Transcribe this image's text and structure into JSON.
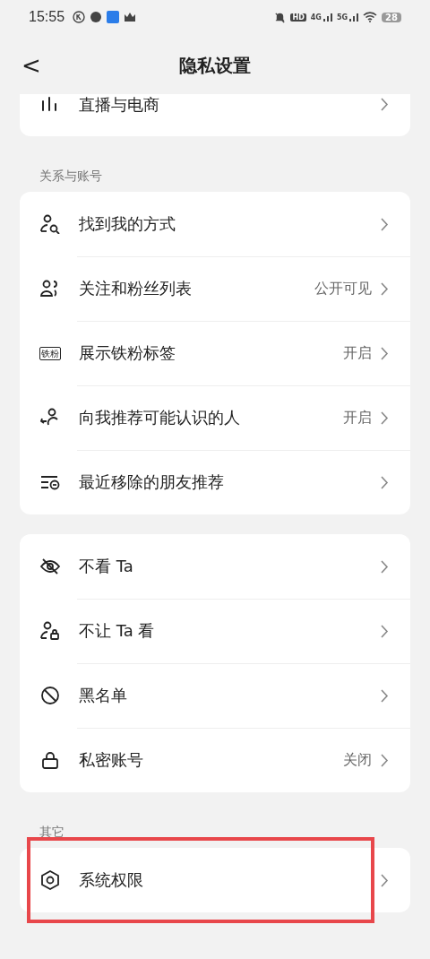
{
  "status_bar": {
    "time": "15:55",
    "hd": "HD",
    "networks": [
      "4G",
      "5G"
    ],
    "battery": "28"
  },
  "header": {
    "back": "<",
    "title": "隐私设置"
  },
  "sections": [
    {
      "rows": [
        {
          "label": "直播与电商",
          "highlighted": false
        }
      ]
    },
    {
      "heading": "关系与账号",
      "rows": [
        {
          "label": "找到我的方式",
          "highlighted": false
        },
        {
          "label": "关注和粉丝列表",
          "value": "公开可见",
          "highlighted": false
        },
        {
          "label": "展示铁粉标签",
          "value": "开启",
          "badge": "铁粉",
          "highlighted": false
        },
        {
          "label": "向我推荐可能认识的人",
          "value": "开启",
          "highlighted": false
        },
        {
          "label": "最近移除的朋友推荐",
          "highlighted": false
        }
      ]
    },
    {
      "rows": [
        {
          "label": "不看 Ta",
          "highlighted": false
        },
        {
          "label": "不让 Ta 看",
          "highlighted": false
        },
        {
          "label": "黑名单",
          "highlighted": false
        },
        {
          "label": "私密账号",
          "value": "关闭",
          "highlighted": false
        }
      ]
    },
    {
      "heading": "其它",
      "rows": [
        {
          "label": "系统权限",
          "highlighted": true
        }
      ]
    }
  ]
}
